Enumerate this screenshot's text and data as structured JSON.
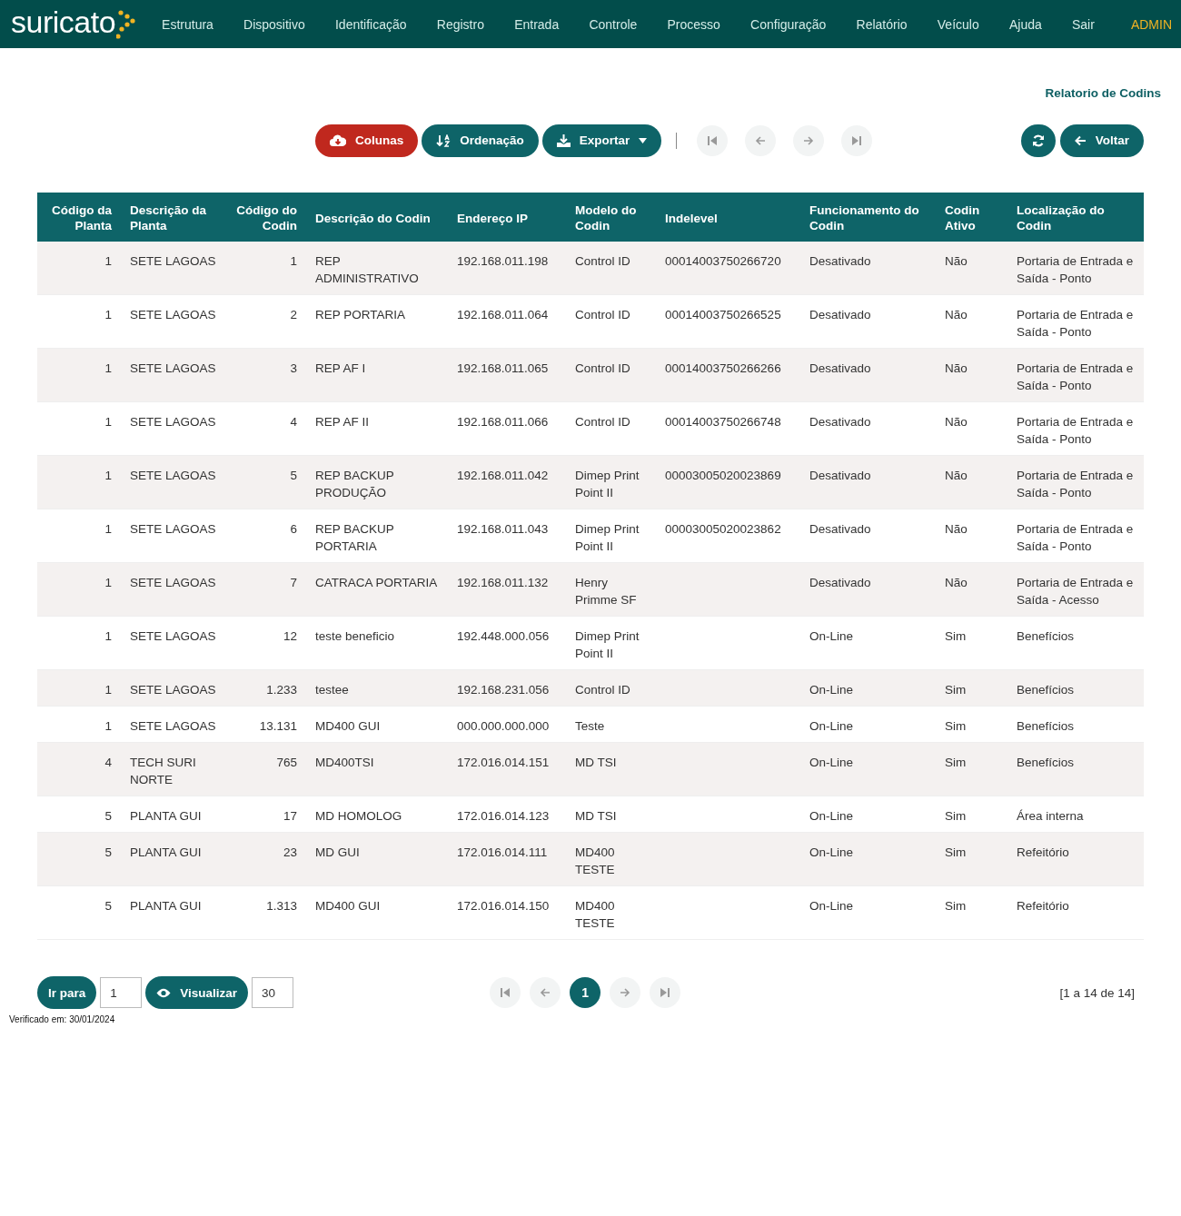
{
  "brand": "suricato",
  "nav": [
    {
      "label": "Estrutura"
    },
    {
      "label": "Dispositivo"
    },
    {
      "label": "Identificação"
    },
    {
      "label": "Registro"
    },
    {
      "label": "Entrada"
    },
    {
      "label": "Controle"
    },
    {
      "label": "Processo"
    },
    {
      "label": "Configuração"
    },
    {
      "label": "Relatório"
    },
    {
      "label": "Veículo"
    },
    {
      "label": "Ajuda"
    },
    {
      "label": "Sair"
    }
  ],
  "user": "ADMIN",
  "page_title": "Relatorio de Codins",
  "toolbar": {
    "buttons": [
      {
        "kind": "columns",
        "label": "Colunas"
      },
      {
        "kind": "sort",
        "label": "Ordenação"
      },
      {
        "kind": "export",
        "label": "Exportar"
      }
    ],
    "pager": [
      {
        "kind": "first",
        "disabled": true
      },
      {
        "kind": "prev",
        "disabled": true
      },
      {
        "kind": "next",
        "disabled": true
      },
      {
        "kind": "last",
        "disabled": true
      }
    ],
    "back": "Voltar"
  },
  "table": {
    "columns": [
      {
        "label": "Código da Planta",
        "kind": "number"
      },
      {
        "label": "Descrição da Planta",
        "kind": "text"
      },
      {
        "label": "Código do Codin",
        "kind": "number"
      },
      {
        "label": "Descrição do Codin",
        "kind": "text"
      },
      {
        "label": "Endereço IP",
        "kind": "text"
      },
      {
        "label": "Modelo do Codin",
        "kind": "text"
      },
      {
        "label": "Indelevel",
        "kind": "text"
      },
      {
        "label": "Funcionamento do Codin",
        "kind": "text"
      },
      {
        "label": "Codin Ativo",
        "kind": "text"
      },
      {
        "label": "Localização do Codin",
        "kind": "text"
      }
    ],
    "rows": [
      [
        "1",
        "SETE LAGOAS",
        "1",
        "REP ADMINISTRATIVO",
        "192.168.011.198",
        "Control ID",
        "00014003750266720",
        "Desativado",
        "Não",
        "Portaria de Entrada e Saída - Ponto"
      ],
      [
        "1",
        "SETE LAGOAS",
        "2",
        "REP PORTARIA",
        "192.168.011.064",
        "Control ID",
        "00014003750266525",
        "Desativado",
        "Não",
        "Portaria de Entrada e Saída - Ponto"
      ],
      [
        "1",
        "SETE LAGOAS",
        "3",
        "REP AF I",
        "192.168.011.065",
        "Control ID",
        "00014003750266266",
        "Desativado",
        "Não",
        "Portaria de Entrada e Saída - Ponto"
      ],
      [
        "1",
        "SETE LAGOAS",
        "4",
        "REP AF II",
        "192.168.011.066",
        "Control ID",
        "00014003750266748",
        "Desativado",
        "Não",
        "Portaria de Entrada e Saída - Ponto"
      ],
      [
        "1",
        "SETE LAGOAS",
        "5",
        "REP BACKUP PRODUÇÃO",
        "192.168.011.042",
        "Dimep Print Point II",
        "00003005020023869",
        "Desativado",
        "Não",
        "Portaria de Entrada e Saída - Ponto"
      ],
      [
        "1",
        "SETE LAGOAS",
        "6",
        "REP BACKUP PORTARIA",
        "192.168.011.043",
        "Dimep Print Point II",
        "00003005020023862",
        "Desativado",
        "Não",
        "Portaria de Entrada e Saída - Ponto"
      ],
      [
        "1",
        "SETE LAGOAS",
        "7",
        "CATRACA PORTARIA",
        "192.168.011.132",
        "Henry Primme SF",
        null,
        "Desativado",
        "Não",
        "Portaria de Entrada e Saída - Acesso"
      ],
      [
        "1",
        "SETE LAGOAS",
        "12",
        "teste beneficio",
        "192.448.000.056",
        "Dimep Print Point II",
        null,
        "On-Line",
        "Sim",
        "Benefícios"
      ],
      [
        "1",
        "SETE LAGOAS",
        "1.233",
        "testee",
        "192.168.231.056",
        "Control ID",
        null,
        "On-Line",
        "Sim",
        "Benefícios"
      ],
      [
        "1",
        "SETE LAGOAS",
        "13.131",
        "MD400 GUI",
        "000.000.000.000",
        "Teste",
        null,
        "On-Line",
        "Sim",
        "Benefícios"
      ],
      [
        "4",
        "TECH SURI NORTE",
        "765",
        "MD400TSI",
        "172.016.014.151",
        "MD TSI",
        null,
        "On-Line",
        "Sim",
        "Benefícios"
      ],
      [
        "5",
        "PLANTA GUI",
        "17",
        "MD HOMOLOG",
        "172.016.014.123",
        "MD TSI",
        null,
        "On-Line",
        "Sim",
        "Área interna"
      ],
      [
        "5",
        "PLANTA GUI",
        "23",
        "MD GUI",
        "172.016.014.111",
        "MD400 TESTE",
        null,
        "On-Line",
        "Sim",
        "Refeitório"
      ],
      [
        "5",
        "PLANTA GUI",
        "1.313",
        "MD400 GUI",
        "172.016.014.150",
        "MD400 TESTE",
        null,
        "On-Line",
        "Sim",
        "Refeitório"
      ]
    ]
  },
  "footer": {
    "goto_label": "Ir para",
    "goto_value": "1",
    "view_label": "Visualizar",
    "view_value": "30",
    "pager": [
      {
        "kind": "first",
        "disabled": true
      },
      {
        "kind": "prev",
        "disabled": true
      },
      {
        "kind": "page",
        "label": "1",
        "selected": true
      },
      {
        "kind": "next",
        "disabled": true
      },
      {
        "kind": "last",
        "disabled": true
      }
    ],
    "range": "[1 a 14 de 14]",
    "verified": "Verificado em: 30/01/2024"
  }
}
